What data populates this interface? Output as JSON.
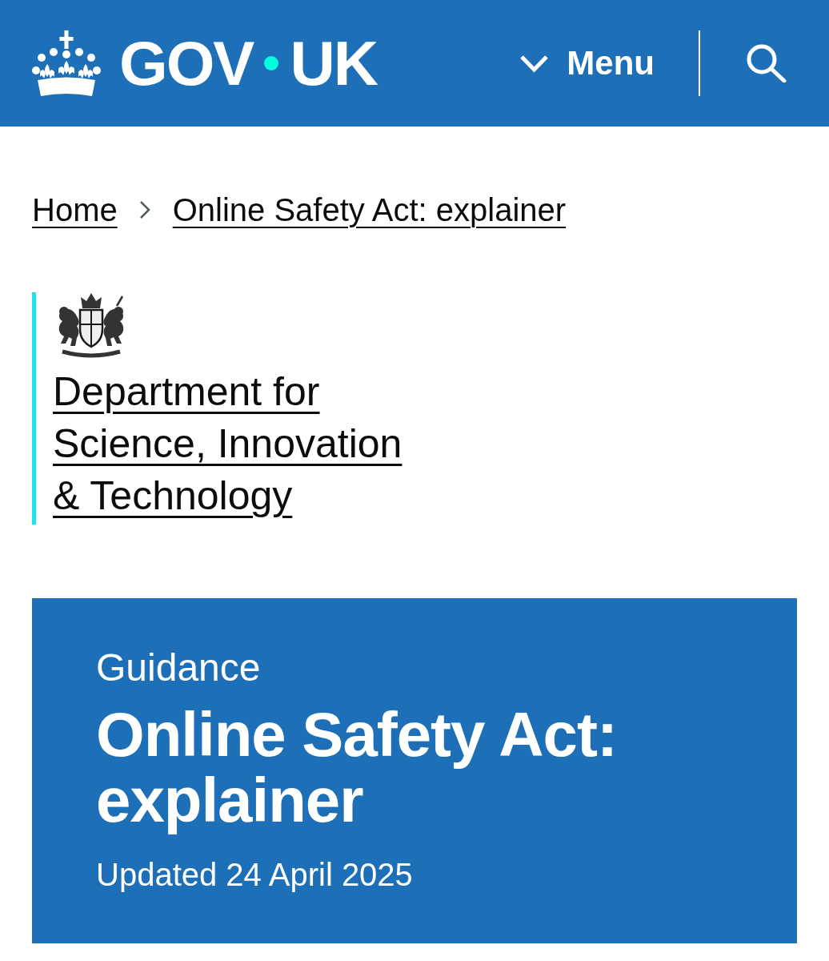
{
  "header": {
    "logo": {
      "words": [
        "GOV",
        "UK"
      ]
    },
    "menu_button": {
      "label": "Menu",
      "expanded": false
    }
  },
  "breadcrumbs": [
    "Home",
    "Online Safety Act: explainer"
  ],
  "organisation": {
    "name": "Department for Science, Innovation & Technology"
  },
  "title_block": {
    "document_type": "Guidance",
    "title": "Online Safety Act: explainer",
    "updated": "Updated 24 April 2025"
  }
}
